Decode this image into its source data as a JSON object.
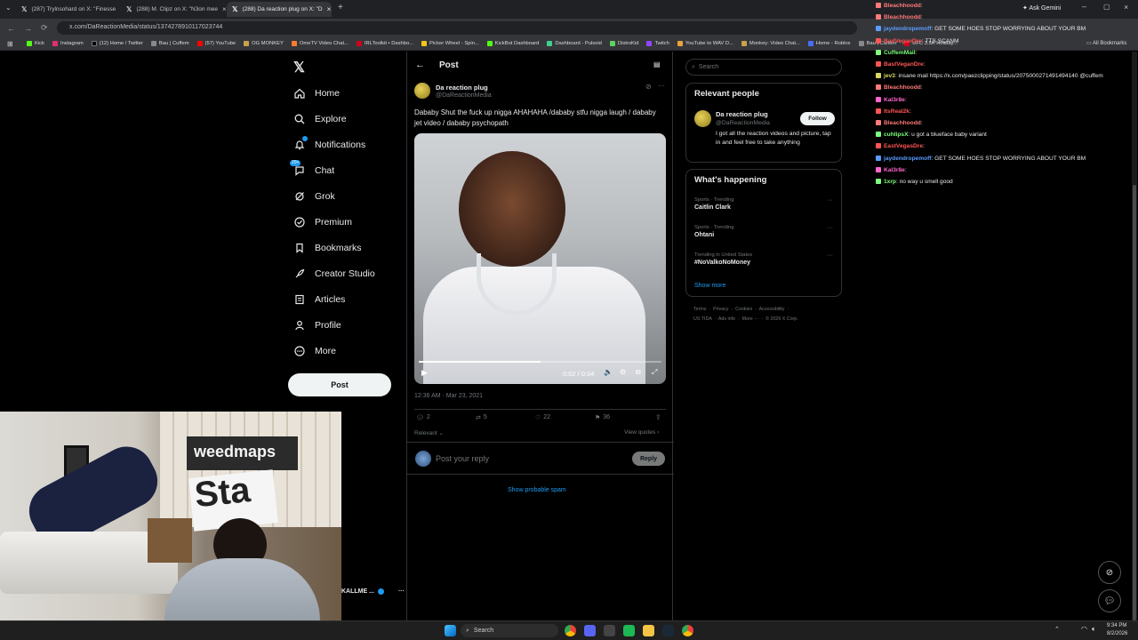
{
  "tabs": [
    {
      "label": "(287) Trylnsohard on X: \"Finesse"
    },
    {
      "label": "(288) M. Clipz on X: \"N3on mee"
    },
    {
      "label": "(288) Da reaction plug on X: \"D"
    }
  ],
  "ask_gemini": "Ask Gemini",
  "address": {
    "url": "x.com/DaReactionMedia/status/1374278910117023744"
  },
  "bookmarks": [
    "Kick",
    "Instagram",
    "(12) Home / Twitter",
    "Bau | Cuffem",
    "(57) YouTube",
    "OG MONKEY",
    "OmeTV Video Chat...",
    "IRLToolkit • Dashbo...",
    "Picker Wheel - Spin...",
    "KickBot Dashboard",
    "Dashboard - Pulsoid",
    "DistroKid",
    "Twitch",
    "YouTube to WAV D...",
    "Monkey: Video Chat...",
    "Home - Roblox",
    "Bau | Cuffem",
    "UFC 3.5K Holiday..."
  ],
  "all_bookmarks": "All Bookmarks",
  "nav": {
    "items": [
      {
        "label": "Home",
        "icon": "home-icon"
      },
      {
        "label": "Explore",
        "icon": "search-icon"
      },
      {
        "label": "Notifications",
        "icon": "bell-icon"
      },
      {
        "label": "Chat",
        "icon": "chat-icon"
      },
      {
        "label": "Grok",
        "icon": "grok-icon"
      },
      {
        "label": "Premium",
        "icon": "premium-icon"
      },
      {
        "label": "Bookmarks",
        "icon": "bookmark-icon"
      },
      {
        "label": "Creator Studio",
        "icon": "rocket-icon"
      },
      {
        "label": "Articles",
        "icon": "article-icon"
      },
      {
        "label": "Profile",
        "icon": "profile-icon"
      },
      {
        "label": "More",
        "icon": "more-icon"
      }
    ],
    "chat_badge": "20+",
    "post_button": "Post",
    "account_name": "KALLME ..."
  },
  "post": {
    "header": "Post",
    "author_name": "Da reaction plug",
    "author_handle": "@DaReactionMedia",
    "text": "Dababy Shut the fuck up nigga AHAHAHA /dababy stfu nigga laugh / dababy jet video / dababy psychopath",
    "video_time": "0:02 / 0:04",
    "video_progress": 0.5,
    "timestamp": "12:36 AM · Mar 23, 2021",
    "replies": "2",
    "reposts": "5",
    "likes": "22",
    "bookmarks": "36",
    "relevant": "Relevant",
    "view_quotes": "View quotes",
    "reply_placeholder": "Post your reply",
    "reply_button": "Reply",
    "show_spam": "Show probable spam"
  },
  "sidebar": {
    "search_placeholder": "Search",
    "relevant_title": "Relevant people",
    "person_name": "Da reaction plug",
    "person_handle": "@DaReactionMedia",
    "person_bio": "I got all the reaction videos and picture, tap in and feel free to take anything",
    "follow": "Follow",
    "happening_title": "What's happening",
    "trends": [
      {
        "meta": "Sports · Trending",
        "name": "Caitlin Clark"
      },
      {
        "meta": "Sports · Trending",
        "name": "Ohtani"
      },
      {
        "meta": "Trending in United States",
        "name": "#NoValkoNoMoney"
      }
    ],
    "show_more": "Show more",
    "footer1": "Terms  ·  Privacy  ·  Cookies  ·  Accessibility  ·",
    "footer2": "US TIDA  ·  Ads info  ·  More ···  ·  © 2026 X Corp."
  },
  "chat": [
    {
      "user": "Bleachhoodd",
      "color": "#ff7a7a",
      "msg": ""
    },
    {
      "user": "Bleachhoodd",
      "color": "#ff7a7a",
      "msg": ""
    },
    {
      "user": "jaydendropemoff",
      "color": "#5b9cff",
      "msg": "GET SOME HOES STOP WORRYING ABOUT YOUR BM"
    },
    {
      "user": "BadVeganDre",
      "color": "#ff5555",
      "msg": "TTS SCANM"
    },
    {
      "user": "CuffemMail",
      "color": "#7cff7c",
      "msg": ""
    },
    {
      "user": "BastVeganDre",
      "color": "#ff5555",
      "msg": ""
    },
    {
      "user": "jev3",
      "color": "#d8d860",
      "msg": "insane mail https://x.com/paezclipping/status/2075000271491494140 @cuffem"
    },
    {
      "user": "Bleachhoodd",
      "color": "#ff7a7a",
      "msg": ""
    },
    {
      "user": "Kal3r8e",
      "color": "#ff66cc",
      "msg": ""
    },
    {
      "user": "ItsReal2k",
      "color": "#ff5555",
      "msg": ""
    },
    {
      "user": "Bleachhoodd",
      "color": "#ff7a7a",
      "msg": ""
    },
    {
      "user": "cuhlipsX",
      "color": "#7cff7c",
      "msg": "u got a blueface baby variant"
    },
    {
      "user": "EastVegasDre",
      "color": "#ff5555",
      "msg": ""
    },
    {
      "user": "jaydendropemoff",
      "color": "#5b9cff",
      "msg": "GET SOME HOES STOP WORRYING ABOUT YOUR BM"
    },
    {
      "user": "Kal3r8e",
      "color": "#ff66cc",
      "msg": ""
    },
    {
      "user": "1xrp",
      "color": "#7cff7c",
      "msg": "no way u smell good"
    }
  ],
  "webcam": {
    "sign": "weedmaps",
    "sign2": "Sta"
  },
  "taskbar": {
    "search": "Search",
    "time": "9:34 PM",
    "date": "8/2/2026"
  }
}
